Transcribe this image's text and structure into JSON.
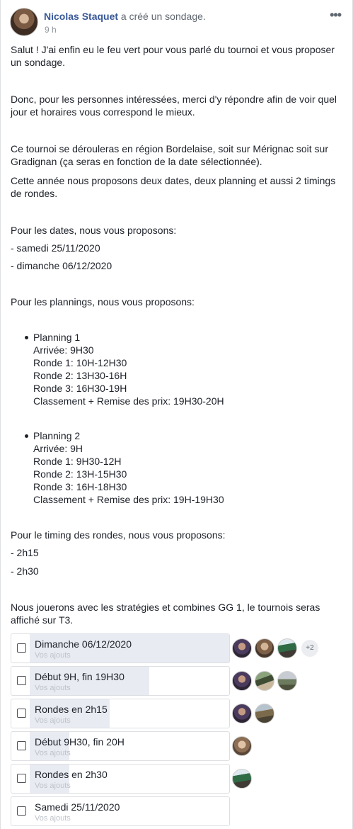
{
  "post": {
    "author": "Nicolas Staquet",
    "action": "a créé un sondage.",
    "time": "9 h",
    "more_label": "•••"
  },
  "content": {
    "p1_l1": "Salut ! J'ai enfin eu le feu vert pour vous parlé du tournoi et vous proposer",
    "p1_l2": "un sondage.",
    "p2_l1": "Donc, pour les personnes intéressées, merci d'y répondre afin de voir quel",
    "p2_l2": "jour et horaires vous correspond le mieux.",
    "p3_l1": "Ce tournoi se dérouleras en région Bordelaise, soit sur Mérignac soit sur",
    "p3_l2": "Gradignan (ça seras en fonction de la date sélectionnée).",
    "p4_l1": "Cette année nous proposons deux dates, deux planning et aussi 2 timings",
    "p4_l2": "de rondes.",
    "dates_intro": "Pour les dates, nous vous proposons:",
    "date_1": "- samedi 25/11/2020",
    "date_2": "- dimanche 06/12/2020",
    "plannings_intro": "Pour les plannings, nous vous proposons:",
    "planning_1": {
      "title": "Planning 1",
      "arrival": "Arrivée: 9H30",
      "r1": "Ronde 1: 10H-12H30",
      "r2": "Ronde 2: 13H30-16H",
      "r3": "Ronde 3: 16H30-19H",
      "ranking": "Classement + Remise des prix: 19H30-20H"
    },
    "planning_2": {
      "title": "Planning 2",
      "arrival": "Arrivée: 9H",
      "r1": "Ronde 1: 9H30-12H",
      "r2": "Ronde 2: 13H-15H30",
      "r3": "Ronde 3: 16H-18H30",
      "ranking": "Classement + Remise des prix: 19H-19H30"
    },
    "timing_intro": "Pour le timing des rondes, nous vous proposons:",
    "timing_1": "- 2h15",
    "timing_2": "- 2h30",
    "closing_l1": "Nous jouerons avec les stratégies et combines GG 1, le tournois seras",
    "closing_l2": "affiché sur T3."
  },
  "poll": {
    "options": [
      {
        "label": "Dimanche 06/12/2020",
        "sub": "Vos ajouts",
        "fill_fraction": 1.0,
        "more_voters": "+2"
      },
      {
        "label": "Début 9H, fin 19H30",
        "sub": "Vos ajouts",
        "fill_fraction": 0.6
      },
      {
        "label": "Rondes en 2h15",
        "sub": "Vos ajouts",
        "fill_fraction": 0.4
      },
      {
        "label": "Début 9H30, fin 20H",
        "sub": "Vos ajouts",
        "fill_fraction": 0.2
      },
      {
        "label": "Rondes en 2h30",
        "sub": "Vos ajouts",
        "fill_fraction": 0.2
      },
      {
        "label": "Samedi 25/11/2020",
        "sub": "Vos ajouts",
        "fill_fraction": 0.0
      }
    ]
  }
}
